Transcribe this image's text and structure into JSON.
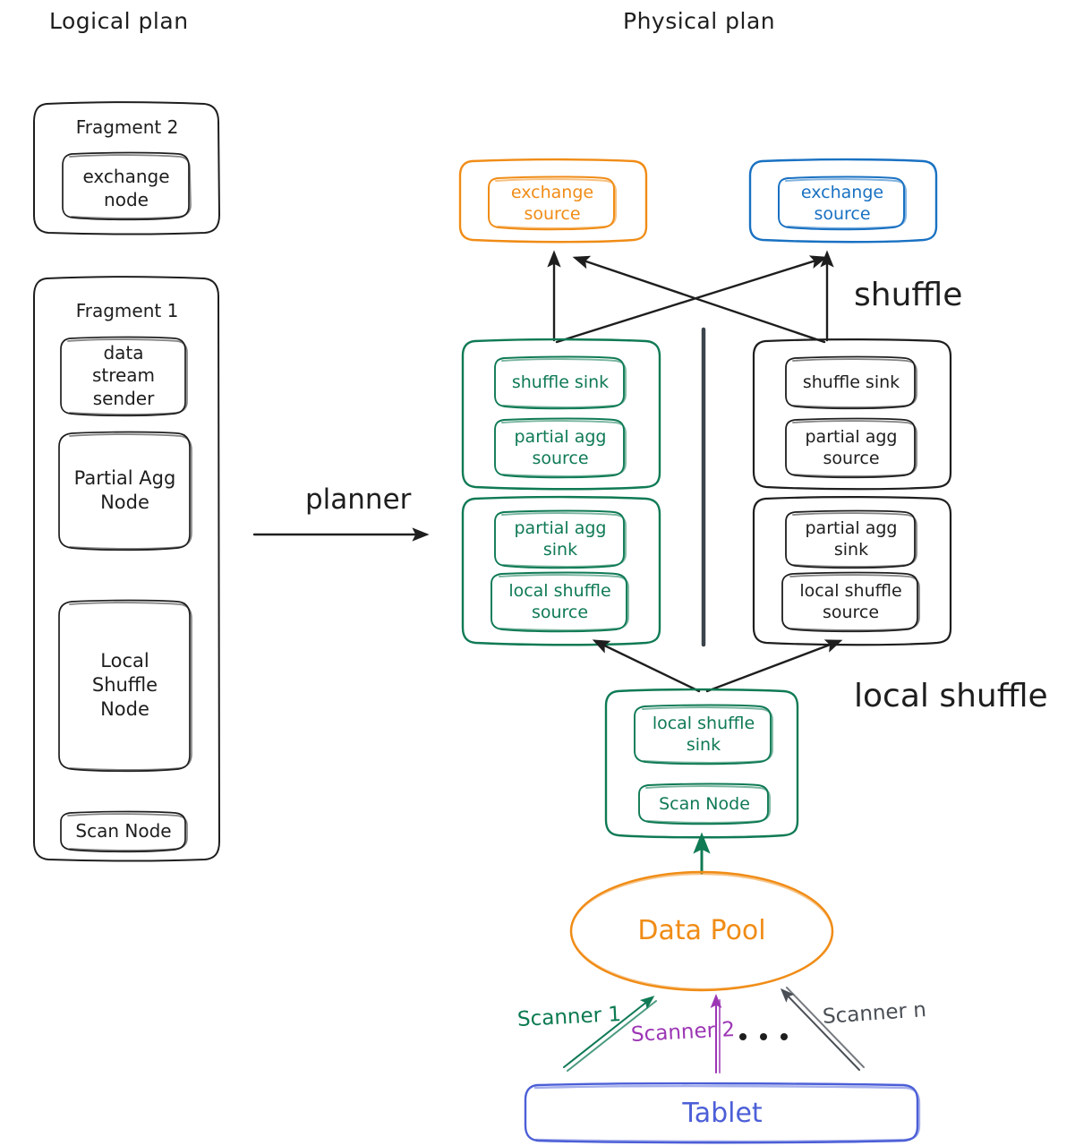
{
  "titles": {
    "logical": "Logical plan",
    "physical": "Physical plan"
  },
  "annotations": {
    "planner": "planner",
    "shuffle": "shuffle",
    "local_shuffle": "local shuffle",
    "ellipsis": ". . ."
  },
  "logical_plan": {
    "fragment2": {
      "label": "Fragment 2",
      "nodes": [
        {
          "label": "exchange\nnode"
        }
      ]
    },
    "fragment1": {
      "label": "Fragment 1",
      "nodes": [
        {
          "label": "data\nstream\nsender"
        },
        {
          "label": "Partial Agg\nNode"
        },
        {
          "label": "Local\nShuffle\nNode"
        },
        {
          "label": "Scan Node"
        }
      ]
    }
  },
  "physical_plan": {
    "exchange_left": {
      "label": "exchange\nsource",
      "color": "#f08c16"
    },
    "exchange_right": {
      "label": "exchange\nsource",
      "color": "#1971c2"
    },
    "pipeline_left_top": {
      "color": "#0f7a54",
      "nodes": [
        {
          "label": "shuffle sink"
        },
        {
          "label": "partial agg\nsource"
        }
      ]
    },
    "pipeline_right_top": {
      "color": "#1e1e1e",
      "nodes": [
        {
          "label": "shuffle sink"
        },
        {
          "label": "partial agg\nsource"
        }
      ]
    },
    "pipeline_left_bottom": {
      "color": "#0f7a54",
      "nodes": [
        {
          "label": "partial agg\nsink"
        },
        {
          "label": "local shuffle\nsource"
        }
      ]
    },
    "pipeline_right_bottom": {
      "color": "#1e1e1e",
      "nodes": [
        {
          "label": "partial agg\nsink"
        },
        {
          "label": "local shuffle\nsource"
        }
      ]
    },
    "scan_pipeline": {
      "color": "#0f7a54",
      "nodes": [
        {
          "label": "local shuffle\nsink"
        },
        {
          "label": "Scan Node"
        }
      ]
    },
    "data_pool": {
      "label": "Data Pool",
      "color": "#f08c16"
    },
    "tablet": {
      "label": "Tablet",
      "color": "#4c5fd7"
    },
    "scanners": [
      {
        "label": "Scanner 1",
        "color": "#0f7a54"
      },
      {
        "label": "Scanner 2",
        "color": "#9c36b5"
      },
      {
        "label": "Scanner n",
        "color": "#4a4f55"
      }
    ]
  },
  "colors": {
    "ink": "#1e1e1e",
    "green": "#0f7a54",
    "orange": "#f08c16",
    "blue": "#1971c2",
    "indigo": "#4c5fd7",
    "purple": "#9c36b5",
    "gray": "#4a4f55",
    "divider": "#3b444b"
  }
}
